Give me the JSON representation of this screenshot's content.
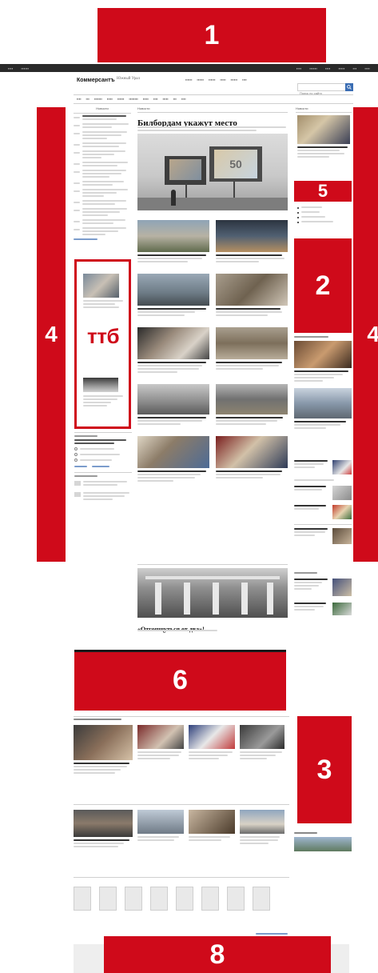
{
  "overlays": {
    "b1": "1",
    "b2": "2",
    "b3": "3",
    "b4_left": "4",
    "b4_right": "4",
    "b5": "5",
    "b6": "6",
    "b8": "8",
    "ttb": "ттб"
  },
  "header": {
    "logo": "Коммерсантъ",
    "region": "Южный Урал",
    "search_placeholder": "Поиск по сайту"
  },
  "sections": {
    "left_title": "Новости",
    "center_title": "Новости",
    "right_title": "Новости"
  },
  "main": {
    "lead_headline": "Билбордам укажут место",
    "bottom_headline": "«Отгонщуться от два»!"
  },
  "icons": {
    "search": "search-icon",
    "user": "user-icon"
  },
  "colors": {
    "overlay_red": "#cf0a1a",
    "accent_blue": "#3a6db3"
  }
}
